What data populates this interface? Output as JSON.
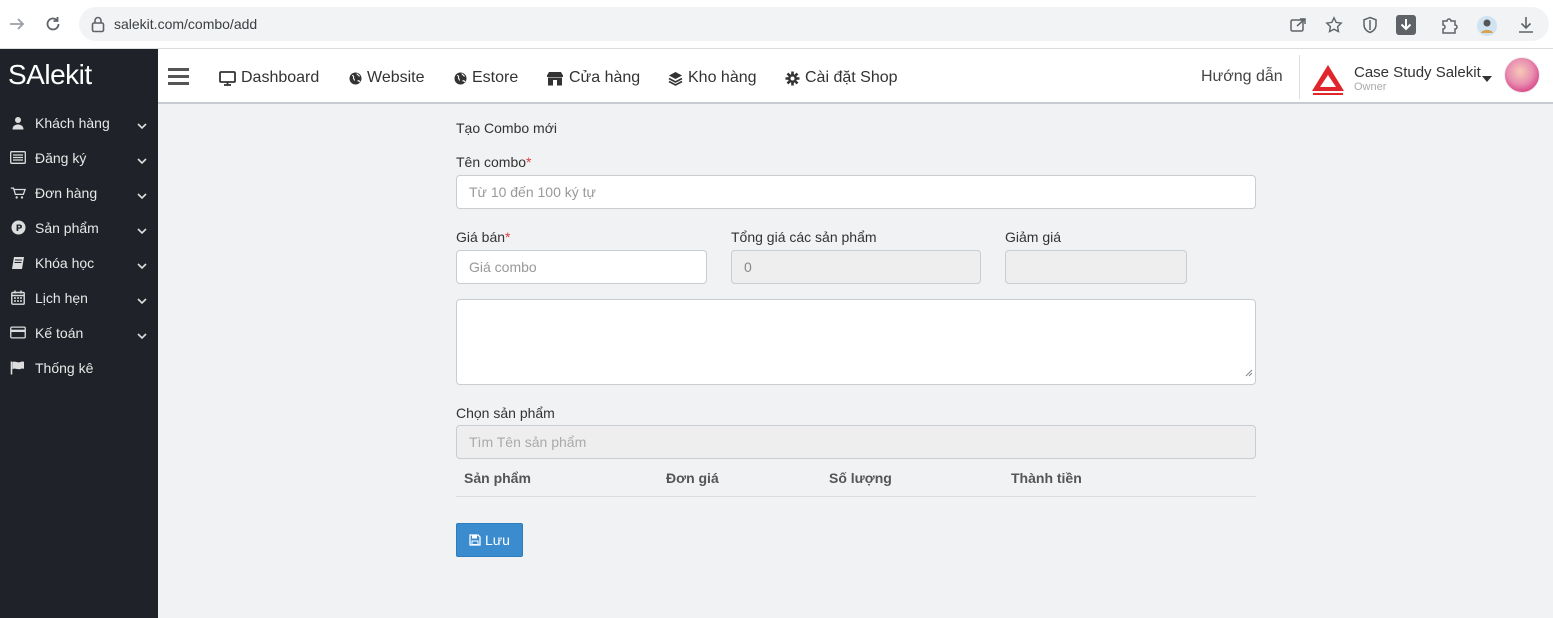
{
  "browser": {
    "url": "salekit.com/combo/add"
  },
  "sidebar": {
    "logo": "SAlekit",
    "items": [
      {
        "label": "Khách hàng",
        "icon": "user-icon",
        "has_children": true
      },
      {
        "label": "Đăng ký",
        "icon": "list-icon",
        "has_children": true
      },
      {
        "label": "Đơn hàng",
        "icon": "cart-icon",
        "has_children": true
      },
      {
        "label": "Sản phẩm",
        "icon": "product-icon",
        "has_children": true
      },
      {
        "label": "Khóa học",
        "icon": "book-icon",
        "has_children": true
      },
      {
        "label": "Lịch hẹn",
        "icon": "calendar-icon",
        "has_children": true
      },
      {
        "label": "Kế toán",
        "icon": "credit-card-icon",
        "has_children": true
      },
      {
        "label": "Thống kê",
        "icon": "flag-icon",
        "has_children": false
      }
    ]
  },
  "header": {
    "nav": [
      {
        "label": "Dashboard",
        "icon": "monitor-icon"
      },
      {
        "label": "Website",
        "icon": "globe-icon"
      },
      {
        "label": "Estore",
        "icon": "globe-icon"
      },
      {
        "label": "Cửa hàng",
        "icon": "store-icon"
      },
      {
        "label": "Kho hàng",
        "icon": "layers-icon"
      },
      {
        "label": "Cài đặt Shop",
        "icon": "gear-icon"
      }
    ],
    "help": "Hướng dẫn",
    "shop_name": "Case Study Salekit",
    "shop_role": "Owner",
    "brand_color": "#e0262b"
  },
  "form": {
    "title": "Tạo Combo mới",
    "combo_name_label": "Tên combo",
    "combo_name_placeholder": "Từ 10 đến 100 ký tự",
    "required_mark": "*",
    "price_label": "Giá bán",
    "price_placeholder": "Giá combo",
    "total_label": "Tổng giá các sản phẩm",
    "total_value": "0",
    "discount_label": "Giảm giá",
    "discount_value": "",
    "choose_product_label": "Chọn sản phẩm",
    "search_placeholder": "Tìm Tên sản phẩm",
    "table_headers": [
      "Sản phẩm",
      "Đơn giá",
      "Số lượng",
      "Thành tiền"
    ],
    "save_label": "Lưu",
    "accent_color": "#3a8ccf"
  }
}
